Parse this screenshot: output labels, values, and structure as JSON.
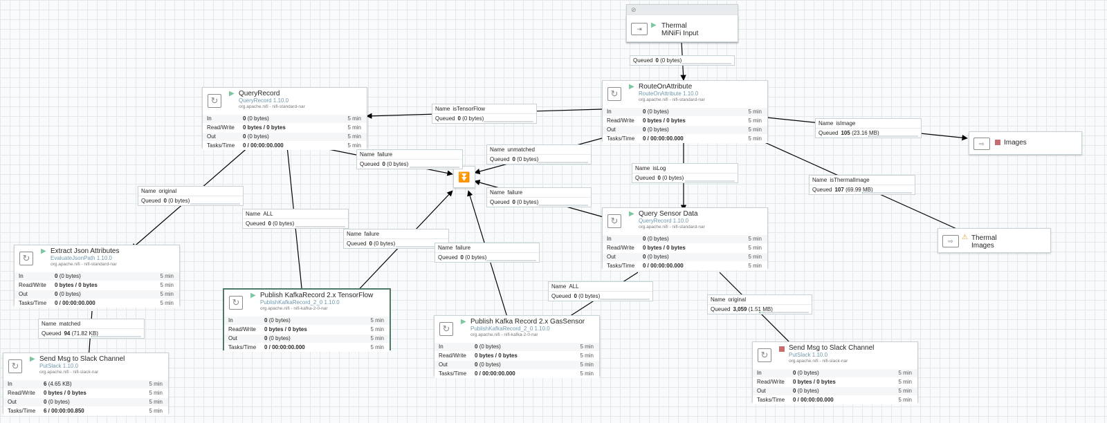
{
  "process_group": {
    "icon": "no-sign-icon"
  },
  "input_port": {
    "name_line1": "Thermal",
    "name_line2": "MiNiFi Input",
    "status": "running"
  },
  "output_ports": [
    {
      "name": "Images",
      "status": "stopped"
    },
    {
      "name_line1": "Thermal",
      "name_line2": "Images",
      "status": "warning"
    }
  ],
  "stat_labels": {
    "in": "In",
    "rw": "Read/Write",
    "out": "Out",
    "tasks": "Tasks/Time"
  },
  "processors": {
    "route": {
      "name": "RouteOnAttribute",
      "type": "RouteOnAttribute 1.10.0",
      "bundle": "org.apache.nifi - nifi-standard-nar",
      "in_v": "0",
      "in_s": "(0 bytes)",
      "in_t": "5 min",
      "rw": "0 bytes / 0 bytes",
      "rw_t": "5 min",
      "out_v": "0",
      "out_s": "(0 bytes)",
      "out_t": "5 min",
      "tasks": "0 / 00:00:00.000",
      "tasks_t": "5 min"
    },
    "query": {
      "name": "QueryRecord",
      "type": "QueryRecord 1.10.0",
      "bundle": "org.apache.nifi - nifi-standard-nar",
      "in_v": "0",
      "in_s": "(0 bytes)",
      "in_t": "5 min",
      "rw": "0 bytes / 0 bytes",
      "rw_t": "5 min",
      "out_v": "0",
      "out_s": "(0 bytes)",
      "out_t": "5 min",
      "tasks": "0 / 00:00:00.000",
      "tasks_t": "5 min"
    },
    "sensor": {
      "name": "Query Sensor Data",
      "type": "QueryRecord 1.10.0",
      "bundle": "org.apache.nifi - nifi-standard-nar",
      "in_v": "0",
      "in_s": "(0 bytes)",
      "in_t": "5 min",
      "rw": "0 bytes / 0 bytes",
      "rw_t": "5 min",
      "out_v": "0",
      "out_s": "(0 bytes)",
      "out_t": "5 min",
      "tasks": "0 / 00:00:00.000",
      "tasks_t": "5 min"
    },
    "extract": {
      "name": "Extract Json Attributes",
      "type": "EvaluateJsonPath 1.10.0",
      "bundle": "org.apache.nifi - nifi-standard-nar",
      "in_v": "0",
      "in_s": "(0 bytes)",
      "in_t": "5 min",
      "rw": "0 bytes / 0 bytes",
      "rw_t": "5 min",
      "out_v": "0",
      "out_s": "(0 bytes)",
      "out_t": "5 min",
      "tasks": "0 / 00:00:00.000",
      "tasks_t": "5 min"
    },
    "kafka_tf": {
      "name": "Publish KafkaRecord 2.x TensorFlow",
      "type": "PublishKafkaRecord_2_0 1.10.0",
      "bundle": "org.apache.nifi - nifi-kafka-2-0-nar",
      "in_v": "0",
      "in_s": "(0 bytes)",
      "in_t": "5 min",
      "rw": "0 bytes / 0 bytes",
      "rw_t": "5 min",
      "out_v": "0",
      "out_s": "(0 bytes)",
      "out_t": "5 min",
      "tasks": "0 / 00:00:00.000",
      "tasks_t": "5 min"
    },
    "kafka_gas": {
      "name": "Publish Kafka Record 2.x GasSensor",
      "type": "PublishKafkaRecord_2_0 1.10.0",
      "bundle": "org.apache.nifi - nifi-kafka-2-0-nar",
      "in_v": "0",
      "in_s": "(0 bytes)",
      "in_t": "5 min",
      "rw": "0 bytes / 0 bytes",
      "rw_t": "5 min",
      "out_v": "0",
      "out_s": "(0 bytes)",
      "out_t": "5 min",
      "tasks": "0 / 00:00:00.000",
      "tasks_t": "5 min"
    },
    "slack1": {
      "name": "Send Msg to Slack Channel",
      "type": "PutSlack 1.10.0",
      "bundle": "org.apache.nifi - nifi-slack-nar",
      "in_v": "6",
      "in_s": "(4.65 KB)",
      "in_t": "5 min",
      "rw": "0 bytes / 0 bytes",
      "rw_t": "5 min",
      "out_v": "0",
      "out_s": "(0 bytes)",
      "out_t": "5 min",
      "tasks": "6 / 00:00:00.850",
      "tasks_t": "5 min"
    },
    "slack2": {
      "name": "Send Msg to Slack Channel",
      "type": "PutSlack 1.10.0",
      "bundle": "org.apache.nifi - nifi-slack-nar",
      "in_v": "0",
      "in_s": "(0 bytes)",
      "in_t": "5 min",
      "rw": "0 bytes / 0 bytes",
      "rw_t": "5 min",
      "out_v": "0",
      "out_s": "(0 bytes)",
      "out_t": "5 min",
      "tasks": "0 / 00:00:00.000",
      "tasks_t": "5 min"
    }
  },
  "conn_labels": {
    "name": "Name",
    "queued": "Queued"
  },
  "connections": {
    "c_input": {
      "name": "",
      "count": "0",
      "size": "(0 bytes)",
      "fill": 0
    },
    "c_tensor": {
      "name": "isTensorFlow",
      "count": "0",
      "size": "(0 bytes)",
      "fill": 0
    },
    "c_image": {
      "name": "isImage",
      "count": "105",
      "size": "(23.16 MB)",
      "fill": 0.02
    },
    "c_unmatched": {
      "name": "unmatched",
      "count": "0",
      "size": "(0 bytes)",
      "fill": 0
    },
    "c_failure_q": {
      "name": "failure",
      "count": "0",
      "size": "(0 bytes)",
      "fill": 0
    },
    "c_islog": {
      "name": "isLog",
      "count": "0",
      "size": "(0 bytes)",
      "fill": 0
    },
    "c_thermal": {
      "name": "isThermalImage",
      "count": "107",
      "size": "(69.99 MB)",
      "fill": 0.02
    },
    "c_failure_s": {
      "name": "failure",
      "count": "0",
      "size": "(0 bytes)",
      "fill": 0
    },
    "c_original_q": {
      "name": "original",
      "count": "0",
      "size": "(0 bytes)",
      "fill": 0
    },
    "c_all_q": {
      "name": "ALL",
      "count": "0",
      "size": "(0 bytes)",
      "fill": 0
    },
    "c_failure_tf": {
      "name": "failure",
      "count": "0",
      "size": "(0 bytes)",
      "fill": 0
    },
    "c_failure_gas": {
      "name": "failure",
      "count": "0",
      "size": "(0 bytes)",
      "fill": 0
    },
    "c_all_s": {
      "name": "ALL",
      "count": "0",
      "size": "(0 bytes)",
      "fill": 0
    },
    "c_original_s": {
      "name": "original",
      "count": "3,059",
      "size": "(1.51 MB)",
      "fill": 0.03
    },
    "c_matched": {
      "name": "matched",
      "count": "94",
      "size": "(71.82 KB)",
      "fill": 0.01
    }
  }
}
